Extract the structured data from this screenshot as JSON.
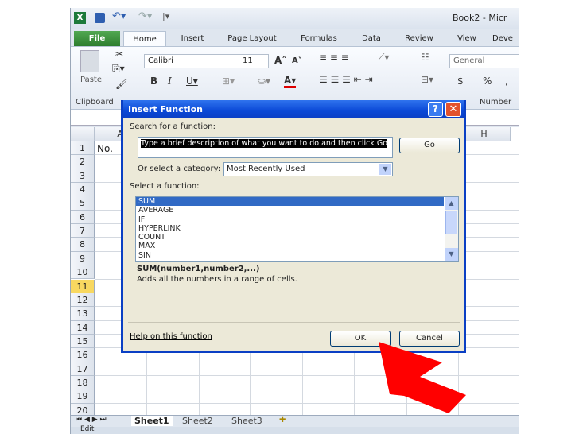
{
  "app": {
    "title": "Book2 - Micr"
  },
  "tabs": [
    "File",
    "Home",
    "Insert",
    "Page Layout",
    "Formulas",
    "Data",
    "Review",
    "View",
    "Deve"
  ],
  "ribbon": {
    "paste": "Paste",
    "font_name": "Calibri",
    "font_size": "11",
    "number_format": "General",
    "groups": [
      "Clipboard",
      "Number"
    ],
    "currency": "$",
    "percent": "%",
    "comma": ","
  },
  "columns": {
    "A": "A",
    "H": "H"
  },
  "rows": [
    "1",
    "2",
    "3",
    "4",
    "5",
    "6",
    "7",
    "8",
    "9",
    "10",
    "11",
    "12",
    "13",
    "14",
    "15",
    "16",
    "17",
    "18",
    "19",
    "20"
  ],
  "active_row": "11",
  "cells": {
    "A1": "No."
  },
  "sheets": [
    "Sheet1",
    "Sheet2",
    "Sheet3"
  ],
  "status": {
    "mode": "Edit"
  },
  "dialog": {
    "title": "Insert Function",
    "search_label": "Search for a function:",
    "search_value": "Type a brief description of what you want to do and then click Go",
    "go": "Go",
    "category_label": "Or select a category:",
    "category_value": "Most Recently Used",
    "select_label": "Select a function:",
    "functions": [
      "SUM",
      "AVERAGE",
      "IF",
      "HYPERLINK",
      "COUNT",
      "MAX",
      "SIN"
    ],
    "selected": "SUM",
    "signature": "SUM(number1,number2,...)",
    "description": "Adds all the numbers in a range of cells.",
    "help": "Help on this function",
    "ok": "OK",
    "cancel": "Cancel"
  },
  "colors": {
    "file_tab": "#3a8a3a",
    "dialog_title": "#0a48d6",
    "selection": "#316ac5",
    "arrow": "#ff0000",
    "active_row": "#f8d860"
  }
}
